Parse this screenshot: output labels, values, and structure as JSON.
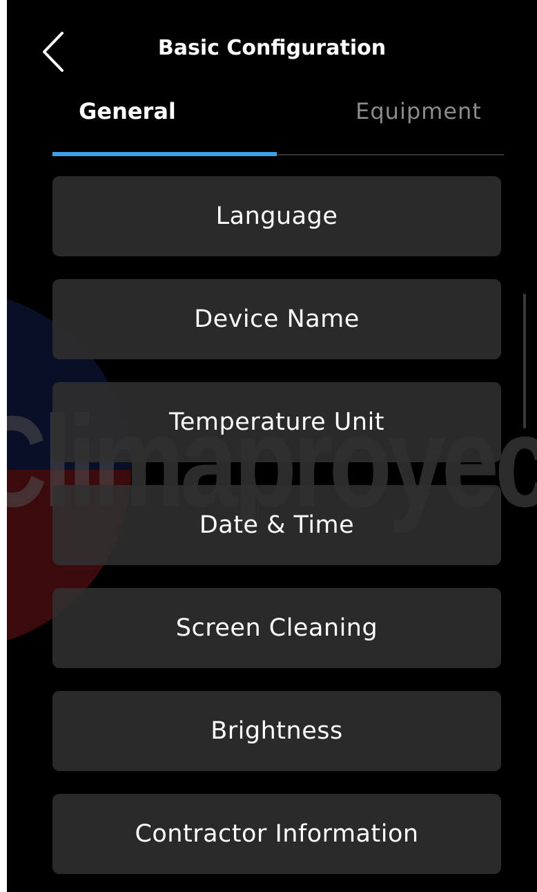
{
  "header": {
    "title": "Basic Configuration",
    "back_icon": "chevron-left-icon"
  },
  "tabs": [
    {
      "label": "General",
      "active": true
    },
    {
      "label": "Equipment",
      "active": false
    }
  ],
  "menu": {
    "items": [
      {
        "label": "Language"
      },
      {
        "label": "Device Name"
      },
      {
        "label": "Temperature Unit"
      },
      {
        "label": "Date & Time"
      },
      {
        "label": "Screen Cleaning"
      },
      {
        "label": "Brightness"
      },
      {
        "label": "Contractor Information"
      }
    ]
  },
  "watermark": {
    "text": "Climaproyecto"
  },
  "colors": {
    "background": "#000000",
    "accent": "#3fa0e8",
    "button_bg": "#303030",
    "inactive_tab": "#8c8c8c"
  }
}
